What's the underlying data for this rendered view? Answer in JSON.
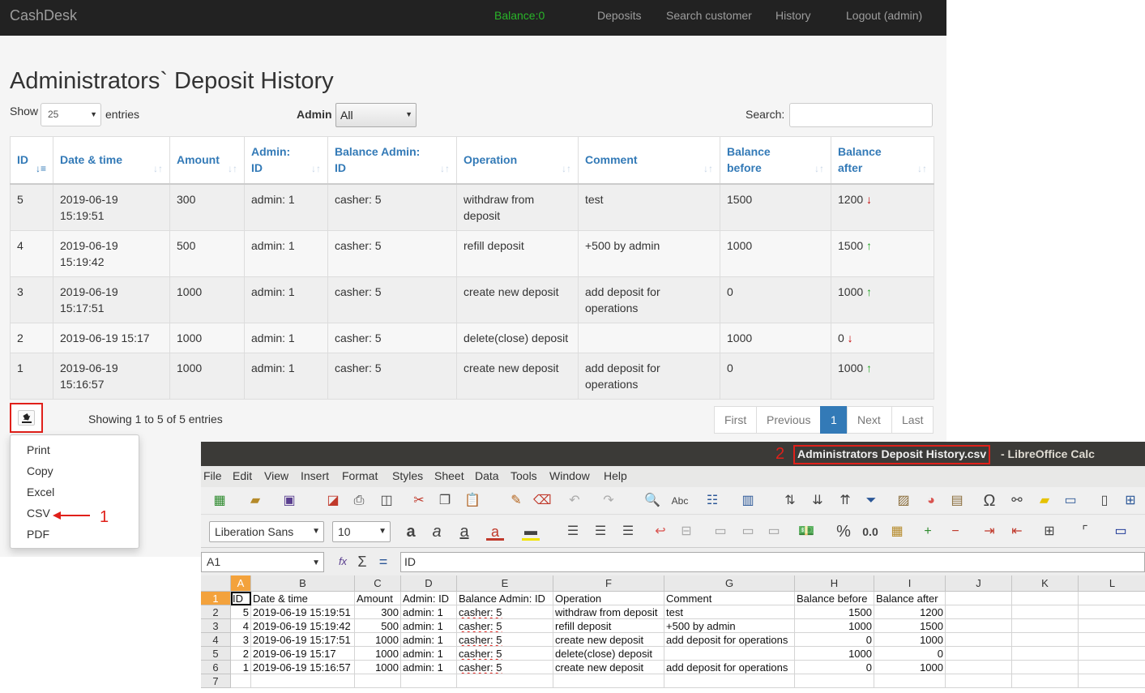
{
  "app": {
    "brand": "CashDesk",
    "balance": "Balance:0",
    "nav": [
      "Deposits",
      "Search customer",
      "History",
      "Logout (admin)"
    ]
  },
  "page": {
    "title": "Administrators` Deposit History",
    "show_label": "Show",
    "entries_value": "25",
    "entries_label": "entries",
    "admin_label": "Admin",
    "admin_value": "All",
    "search_label": "Search:",
    "search_value": ""
  },
  "table": {
    "headers": [
      {
        "line1": "ID",
        "line2": ""
      },
      {
        "line1": "Date & time",
        "line2": ""
      },
      {
        "line1": "Amount",
        "line2": ""
      },
      {
        "line1": "Admin:",
        "line2": "ID"
      },
      {
        "line1": "Balance Admin:",
        "line2": "ID"
      },
      {
        "line1": "Operation",
        "line2": ""
      },
      {
        "line1": "Comment",
        "line2": ""
      },
      {
        "line1": "Balance",
        "line2": "before"
      },
      {
        "line1": "Balance",
        "line2": "after"
      }
    ],
    "rows": [
      {
        "id": "5",
        "date": "2019-06-19 15:19:51",
        "amount": "300",
        "admin": "admin: 1",
        "balance_admin": "casher: 5",
        "operation": "withdraw from deposit",
        "comment": "test",
        "before": "1500",
        "after": "1200",
        "trend": "down"
      },
      {
        "id": "4",
        "date": "2019-06-19 15:19:42",
        "amount": "500",
        "admin": "admin: 1",
        "balance_admin": "casher: 5",
        "operation": "refill deposit",
        "comment": "+500 by admin",
        "before": "1000",
        "after": "1500",
        "trend": "up"
      },
      {
        "id": "3",
        "date": "2019-06-19 15:17:51",
        "amount": "1000",
        "admin": "admin: 1",
        "balance_admin": "casher: 5",
        "operation": "create new deposit",
        "comment": "add deposit for operations",
        "before": "0",
        "after": "1000",
        "trend": "up"
      },
      {
        "id": "2",
        "date": "2019-06-19 15:17",
        "amount": "1000",
        "admin": "admin: 1",
        "balance_admin": "casher: 5",
        "operation": "delete(close) deposit",
        "comment": "",
        "before": "1000",
        "after": "0",
        "trend": "down"
      },
      {
        "id": "1",
        "date": "2019-06-19 15:16:57",
        "amount": "1000",
        "admin": "admin: 1",
        "balance_admin": "casher: 5",
        "operation": "create new deposit",
        "comment": "add deposit for operations",
        "before": "0",
        "after": "1000",
        "trend": "up"
      }
    ]
  },
  "footer": {
    "info": "Showing 1 to 5 of 5 entries",
    "pagination": [
      "First",
      "Previous",
      "1",
      "Next",
      "Last"
    ]
  },
  "export_menu": {
    "items": [
      "Print",
      "Copy",
      "Excel",
      "CSV",
      "PDF"
    ],
    "annotation": "1"
  },
  "calc": {
    "title_number": "2",
    "file_name": "Administrators Deposit History.csv",
    "app_suffix": "- LibreOffice Calc",
    "menu": [
      "File",
      "Edit",
      "View",
      "Insert",
      "Format",
      "Styles",
      "Sheet",
      "Data",
      "Tools",
      "Window",
      "Help"
    ],
    "font_name": "Liberation Sans",
    "font_size": "10",
    "name_box": "A1",
    "formula": "ID",
    "columns": [
      "A",
      "B",
      "C",
      "D",
      "E",
      "F",
      "G",
      "H",
      "I",
      "J",
      "K",
      "L"
    ],
    "row_numbers": [
      "1",
      "2",
      "3",
      "4",
      "5",
      "6",
      "7"
    ],
    "sheet": [
      [
        "ID",
        "Date & time",
        "Amount",
        "Admin: ID",
        "Balance Admin: ID",
        "Operation",
        "Comment",
        "Balance before",
        "Balance after"
      ],
      [
        "5",
        "2019-06-19 15:19:51",
        "300",
        "admin: 1",
        "casher: 5",
        "withdraw from deposit",
        "test",
        "1500",
        "1200"
      ],
      [
        "4",
        "2019-06-19 15:19:42",
        "500",
        "admin: 1",
        "casher: 5",
        "refill deposit",
        "+500 by admin",
        "1000",
        "1500"
      ],
      [
        "3",
        "2019-06-19 15:17:51",
        "1000",
        "admin: 1",
        "casher: 5",
        "create new deposit",
        "add deposit for operations",
        "0",
        "1000"
      ],
      [
        "2",
        "2019-06-19 15:17",
        "1000",
        "admin: 1",
        "casher: 5",
        "delete(close) deposit",
        "",
        "1000",
        "0"
      ],
      [
        "1",
        "2019-06-19 15:16:57",
        "1000",
        "admin: 1",
        "casher: 5",
        "create new deposit",
        "add deposit for operations",
        "0",
        "1000"
      ]
    ]
  },
  "colors": {
    "balance": "#29b529",
    "link": "#337ab7",
    "annotation": "#e0201a",
    "down": "#c20000",
    "up": "#1ea21e"
  }
}
